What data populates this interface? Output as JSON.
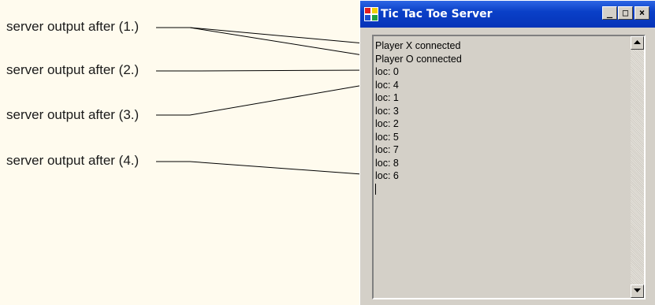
{
  "window": {
    "title": "Tic Tac Toe Server",
    "minimize_label": "_",
    "maximize_label": "□",
    "close_label": "×"
  },
  "callouts": [
    "server output after (1.)",
    "server output after (2.)",
    "server output after (3.)",
    "server output after (4.)"
  ],
  "log_lines": [
    "Player X connected",
    "Player O connected",
    "loc: 0",
    "loc: 4",
    "loc: 1",
    "loc: 3",
    "loc: 2",
    "loc: 5",
    "loc: 7",
    "loc: 8",
    "loc: 6"
  ],
  "colors": {
    "page_background": "#fffbee",
    "titlebar": "#0a40c8",
    "window_face": "#d4d0c8"
  }
}
